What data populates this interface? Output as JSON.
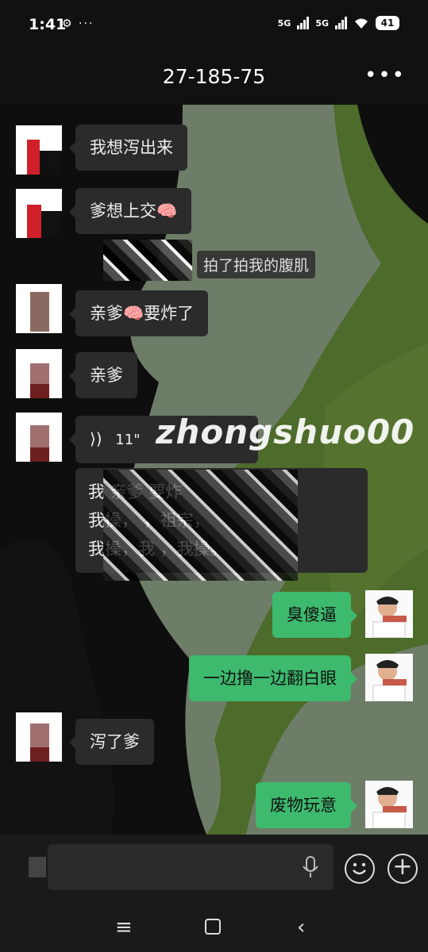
{
  "status_bar": {
    "time": "1:41",
    "extra": "⚙ ···",
    "network1": "5G",
    "network2": "5G",
    "battery": "41"
  },
  "header": {
    "title": "27-185-75",
    "more_icon": "more-icon"
  },
  "messages": {
    "m1": "我想泻出来",
    "m2": "爹想上交🧠",
    "pat": "拍了拍我的腹肌",
    "m3": "亲爹🧠要炸了",
    "m4": "亲爹",
    "voice_duration": "11\"",
    "m5_line1": "我  亲爹      要炸",
    "m5_line2": "  我操，      ，祖宗，",
    "m5_line3": "我操，我      ，我操。",
    "o1": "臭傻逼",
    "o2": "一边撸一边翻白眼",
    "m6": "泻了爹",
    "o3": "废物玩意"
  },
  "watermark": "zhongshuo00",
  "input": {
    "placeholder": ""
  },
  "colors": {
    "accent": "#3dba6e",
    "bubble_in": "#2b2b2b",
    "background_green": "#4d6b2a"
  }
}
